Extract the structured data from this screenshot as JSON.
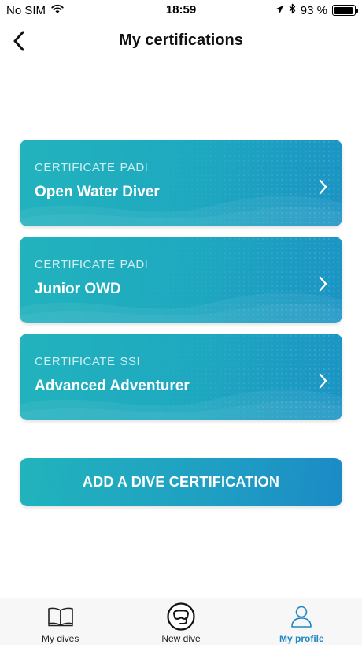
{
  "status_bar": {
    "carrier": "No SIM",
    "time": "18:59",
    "battery_percent": "93 %",
    "battery_level": 0.93
  },
  "nav": {
    "title": "My certifications"
  },
  "certifications": [
    {
      "type": "CERTIFICATE",
      "org": "PADI",
      "name": "Open Water Diver"
    },
    {
      "type": "CERTIFICATE",
      "org": "PADI",
      "name": "Junior OWD"
    },
    {
      "type": "CERTIFICATE",
      "org": "SSI",
      "name": "Advanced Adventurer"
    }
  ],
  "add_button": {
    "label": "ADD A DIVE CERTIFICATION"
  },
  "tabs": [
    {
      "label": "My dives",
      "icon": "book-icon",
      "active": false
    },
    {
      "label": "New dive",
      "icon": "dive-mask-icon",
      "active": false
    },
    {
      "label": "My profile",
      "icon": "user-icon",
      "active": true
    }
  ],
  "colors": {
    "accent": "#1f89c1",
    "card_start": "#22b3bd",
    "card_end": "#1b93c4"
  }
}
